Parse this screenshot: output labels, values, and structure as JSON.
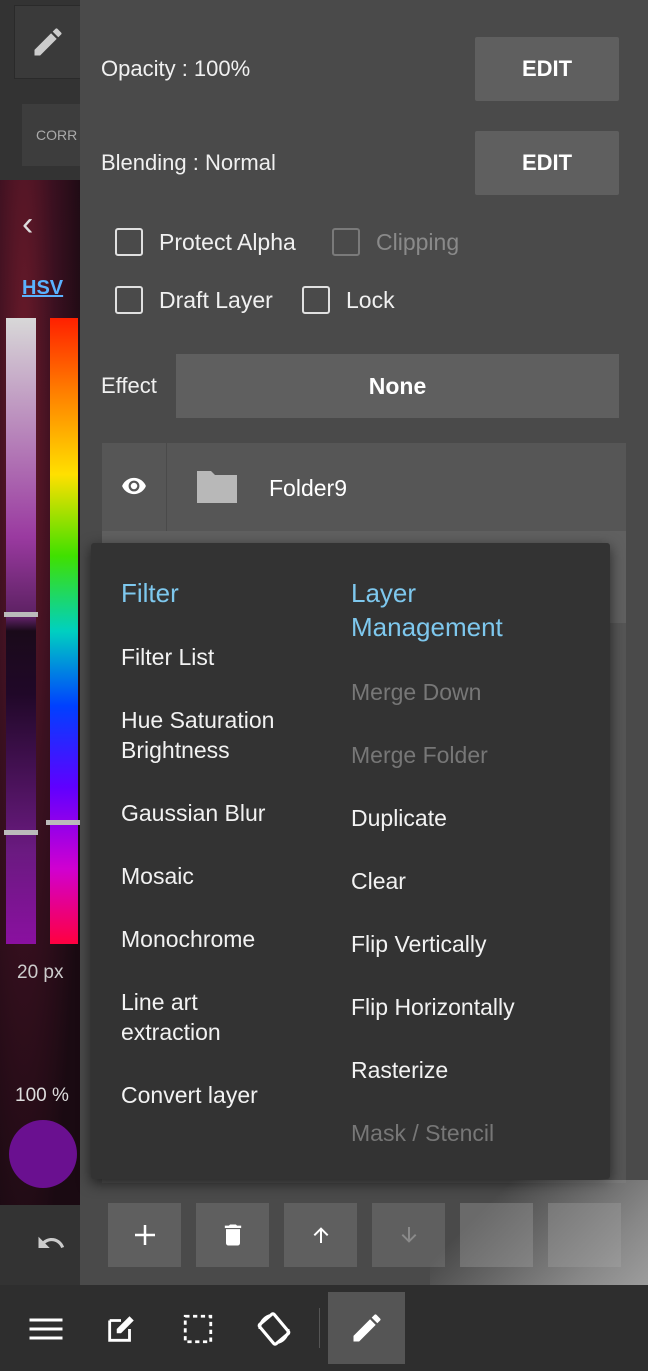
{
  "left": {
    "corr_label": "CORR",
    "hsv_label": "HSV",
    "brush_size": "20 px",
    "opacity_small": "100 %",
    "color": "#6a1090"
  },
  "panel": {
    "opacity_label": "Opacity : 100%",
    "blending_label": "Blending : Normal",
    "edit_label": "EDIT",
    "checkboxes": {
      "protect_alpha": "Protect Alpha",
      "clipping": "Clipping",
      "draft_layer": "Draft Layer",
      "lock": "Lock"
    },
    "effect_label": "Effect",
    "effect_value": "None",
    "layer_name": "Folder9"
  },
  "menu": {
    "filter_header": "Filter",
    "filter_items": [
      "Filter List",
      "Hue Saturation Brightness",
      "Gaussian Blur",
      "Mosaic",
      "Monochrome",
      "Line art extraction",
      "Convert layer"
    ],
    "layer_header": "Layer Management",
    "layer_items": [
      {
        "label": "Merge Down",
        "enabled": false
      },
      {
        "label": "Merge Folder",
        "enabled": false
      },
      {
        "label": "Duplicate",
        "enabled": true
      },
      {
        "label": "Clear",
        "enabled": true
      },
      {
        "label": "Flip Vertically",
        "enabled": true
      },
      {
        "label": "Flip Horizontally",
        "enabled": true
      },
      {
        "label": "Rasterize",
        "enabled": true
      },
      {
        "label": "Mask / Stencil",
        "enabled": false
      }
    ]
  },
  "layer_buttons": [
    "add-icon",
    "trash-icon",
    "arrow-up-icon",
    "arrow-down-icon"
  ],
  "toolbar": [
    "menu-icon",
    "edit-box-icon",
    "selection-icon",
    "rotate-icon",
    "pencil-icon"
  ]
}
